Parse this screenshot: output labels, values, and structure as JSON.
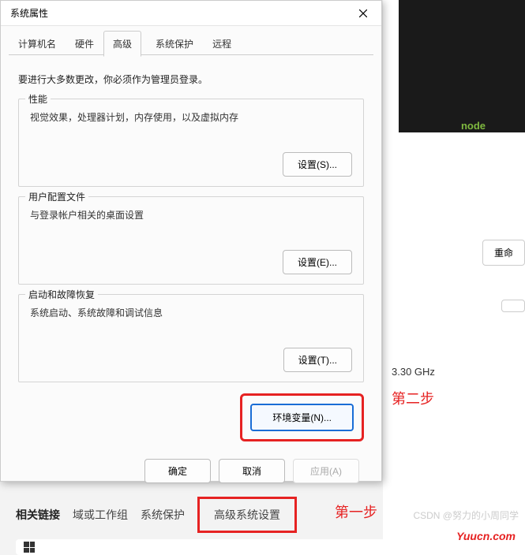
{
  "dialog": {
    "title": "系统属性",
    "info": "要进行大多数更改，你必须作为管理员登录。",
    "tabs": [
      {
        "label": "计算机名"
      },
      {
        "label": "硬件"
      },
      {
        "label": "高级",
        "active": true
      },
      {
        "label": "系统保护"
      },
      {
        "label": "远程"
      }
    ],
    "groups": {
      "performance": {
        "title": "性能",
        "desc": "视觉效果，处理器计划，内存使用，以及虚拟内存",
        "btn": "设置(S)..."
      },
      "userprofile": {
        "title": "用户配置文件",
        "desc": "与登录帐户相关的桌面设置",
        "btn": "设置(E)..."
      },
      "startup": {
        "title": "启动和故障恢复",
        "desc": "系统启动、系统故障和调试信息",
        "btn": "设置(T)..."
      }
    },
    "env_btn": "环境变量(N)...",
    "footer": {
      "ok": "确定",
      "cancel": "取消",
      "apply": "应用(A)"
    }
  },
  "background": {
    "node_text": "node",
    "rename_btn": "重命",
    "ghz": "3.30 GHz"
  },
  "annotations": {
    "step1": "第一步",
    "step2": "第二步"
  },
  "related": {
    "label": "相关链接",
    "links": [
      "域或工作组",
      "系统保护",
      "高级系统设置"
    ]
  },
  "watermark": "CSDN @努力的小周同学",
  "credit": "Yuucn.com"
}
